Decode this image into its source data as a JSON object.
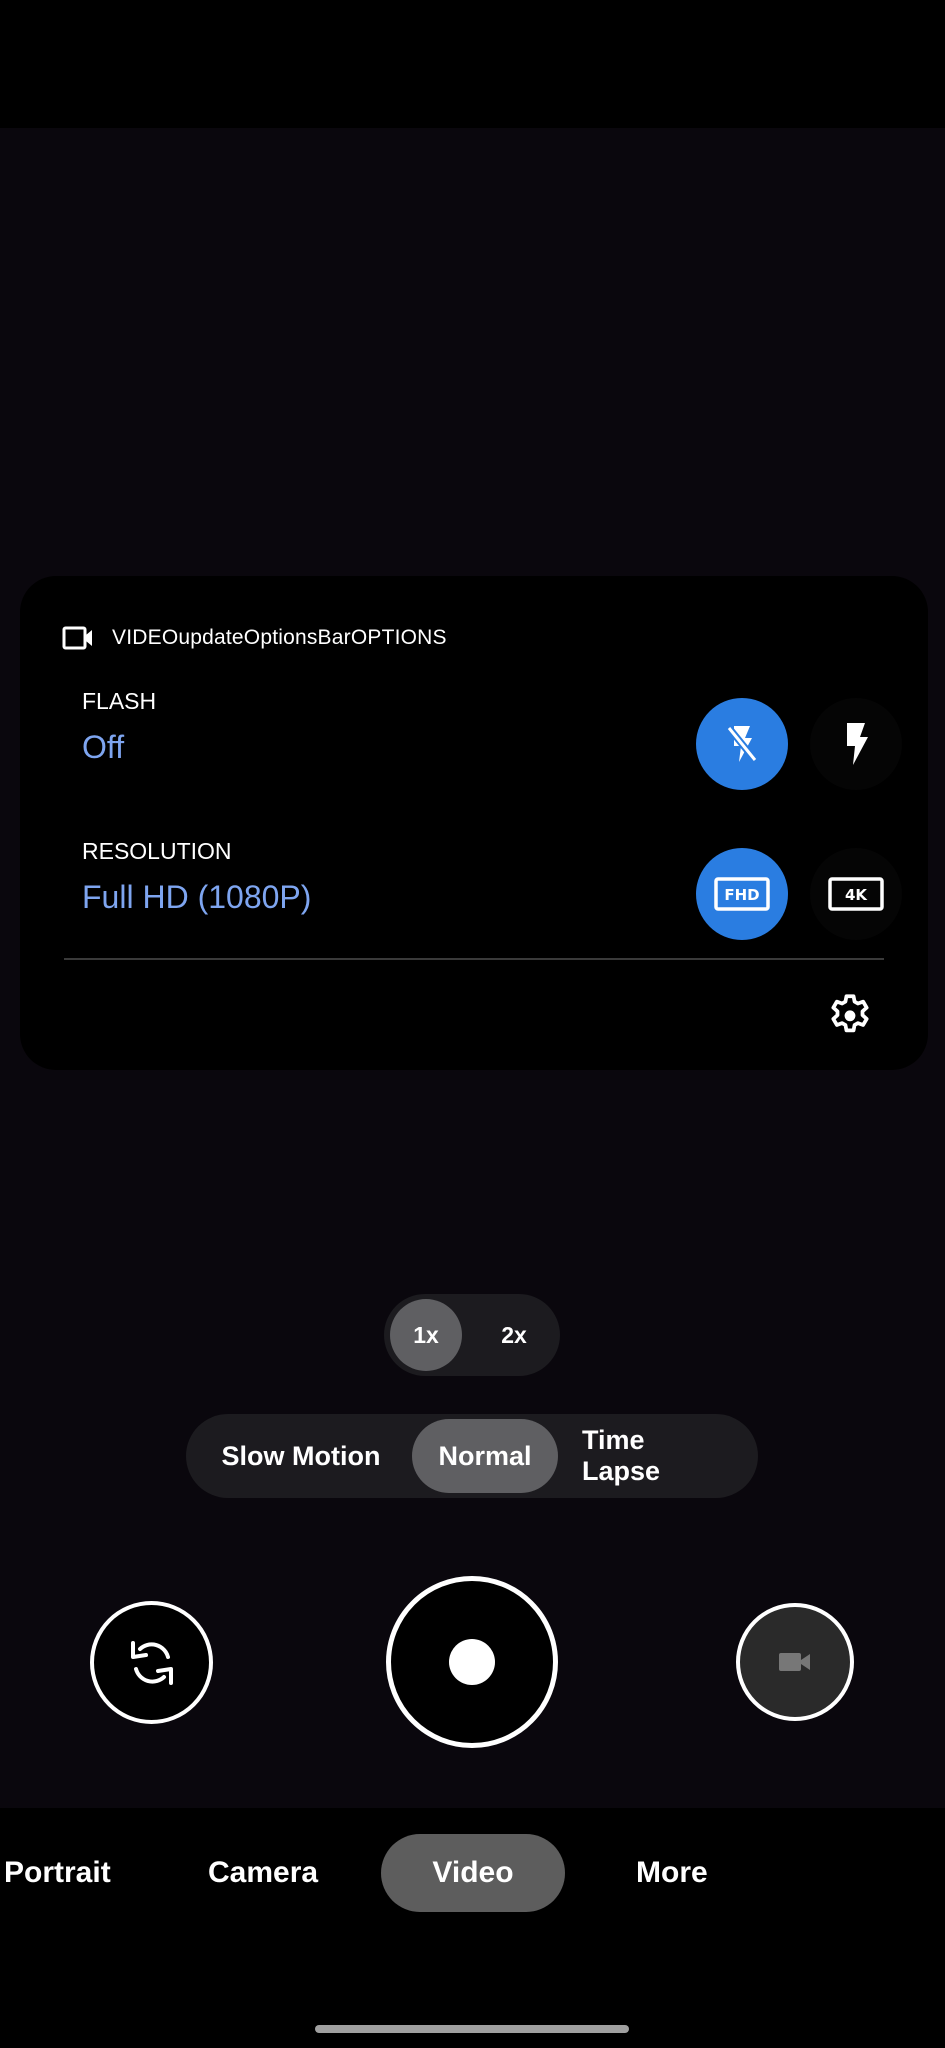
{
  "options_panel": {
    "header_icon": "videocam-outline-icon",
    "title": "VIDEOupdateOptionsBarOPTIONS",
    "flash": {
      "label": "FLASH",
      "value": "Off",
      "options": [
        {
          "icon": "flash-off-icon",
          "selected": true
        },
        {
          "icon": "flash-on-icon",
          "selected": false
        }
      ]
    },
    "resolution": {
      "label": "RESOLUTION",
      "value": "Full HD (1080P)",
      "options": [
        {
          "icon": "fhd-icon",
          "label": "FHD",
          "selected": true
        },
        {
          "icon": "4k-icon",
          "label": "4K",
          "selected": false
        }
      ]
    },
    "settings_icon": "gear-icon"
  },
  "zoom": {
    "options": [
      "1x",
      "2x"
    ],
    "selected": "1x"
  },
  "capture_modes": {
    "options": [
      "Slow Motion",
      "Normal",
      "Time Lapse"
    ],
    "selected": "Normal"
  },
  "controls": {
    "flip_icon": "camera-flip-icon",
    "shutter_icon": "record-icon",
    "gallery_icon": "videocam-icon"
  },
  "mode_tabs": {
    "items": [
      "Portrait",
      "Camera",
      "Video",
      "More"
    ],
    "selected": "Video"
  },
  "colors": {
    "accent": "#2a7de1",
    "value_text": "#7ea5f0",
    "selected_pill": "#5f5f62",
    "pill_bg": "#1c1b1f"
  }
}
